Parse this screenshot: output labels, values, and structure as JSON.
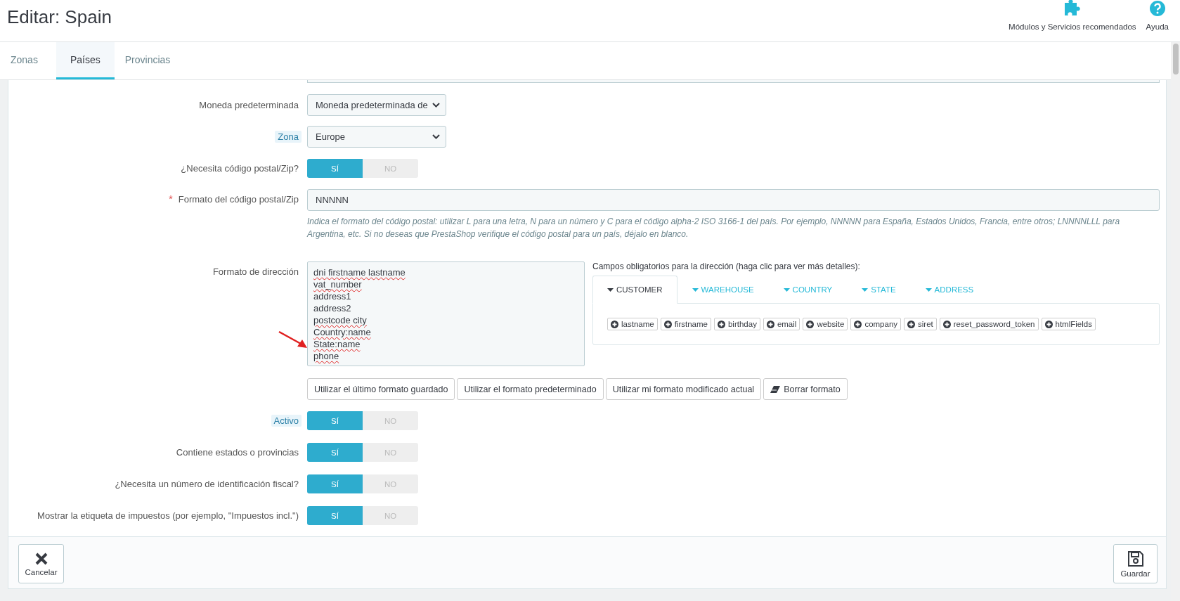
{
  "header": {
    "title": "Editar: Spain",
    "actions": [
      {
        "kind": "modules",
        "label": "Módulos y Servicios recomendados"
      },
      {
        "kind": "help",
        "label": "Ayuda"
      }
    ]
  },
  "tabs": [
    {
      "label": "Zonas",
      "selected": false
    },
    {
      "label": "Países",
      "selected": true
    },
    {
      "label": "Provincias",
      "selected": false
    }
  ],
  "fields": [
    {
      "kind": "select",
      "label": "Moneda predeterminada",
      "hint": false,
      "value": "Moneda predeterminada de"
    },
    {
      "kind": "select",
      "label": "Zona",
      "hint": true,
      "value": "Europe"
    },
    {
      "kind": "switch",
      "label": "¿Necesita código postal/Zip?",
      "hint": false,
      "yes": "SÍ",
      "no": "NO",
      "on": true
    },
    {
      "kind": "text",
      "label": "Formato del código postal/Zip",
      "hint": false,
      "required_mark": "*",
      "value": "NNNNN",
      "help": "Indica el formato del código postal: utilizar L para una letra, N para un número y C para el código alpha-2 ISO 3166-1 del país. Por ejemplo, NNNNN para España, Estados Unidos, Francia, entre otros; LNNNNLLL para Argentina, etc. Si no deseas que PrestaShop verifique el código postal para un país, déjalo en blanco."
    },
    {
      "kind": "address",
      "label": "Formato de dirección",
      "hint": false,
      "lines": [
        {
          "text": "dni firstname lastname",
          "flagged": true
        },
        {
          "text": "vat_number",
          "flagged": true
        },
        {
          "text": "address1",
          "flagged": false
        },
        {
          "text": "address2",
          "flagged": false
        },
        {
          "text": "postcode city",
          "flagged": true
        },
        {
          "text": "Country:name",
          "flagged": true
        },
        {
          "text": "State:name",
          "flagged": true
        },
        {
          "text": "phone",
          "flagged": true
        }
      ],
      "fields_title": "Campos obligatorios para la dirección (haga clic para ver más detalles):",
      "field_tabs": [
        {
          "label": "CUSTOMER",
          "selected": true
        },
        {
          "label": "WAREHOUSE",
          "selected": false
        },
        {
          "label": "COUNTRY",
          "selected": false
        },
        {
          "label": "STATE",
          "selected": false
        },
        {
          "label": "ADDRESS",
          "selected": false
        }
      ],
      "chips": [
        "lastname",
        "firstname",
        "birthday",
        "email",
        "website",
        "company",
        "siret",
        "reset_password_token",
        "htmlFields"
      ],
      "buttons": [
        {
          "label": "Utilizar el último formato guardado",
          "kind": "plain"
        },
        {
          "label": "Utilizar el formato predeterminado",
          "kind": "plain"
        },
        {
          "label": "Utilizar mi formato modificado actual",
          "kind": "plain"
        },
        {
          "label": "Borrar formato",
          "kind": "eraser"
        }
      ]
    },
    {
      "kind": "switch",
      "label": "Activo",
      "hint": true,
      "yes": "SÍ",
      "no": "NO",
      "on": true
    },
    {
      "kind": "switch",
      "label": "Contiene estados o provincias",
      "hint": false,
      "yes": "SÍ",
      "no": "NO",
      "on": true
    },
    {
      "kind": "switch",
      "label": "¿Necesita un número de identificación fiscal?",
      "hint": false,
      "yes": "SÍ",
      "no": "NO",
      "on": true
    },
    {
      "kind": "switch",
      "label": "Mostrar la etiqueta de impuestos (por ejemplo, \"Impuestos incl.\")",
      "hint": false,
      "yes": "SÍ",
      "no": "NO",
      "on": true
    }
  ],
  "footer": [
    {
      "kind": "cancel",
      "label": "Cancelar"
    },
    {
      "kind": "save",
      "label": "Guardar"
    }
  ]
}
